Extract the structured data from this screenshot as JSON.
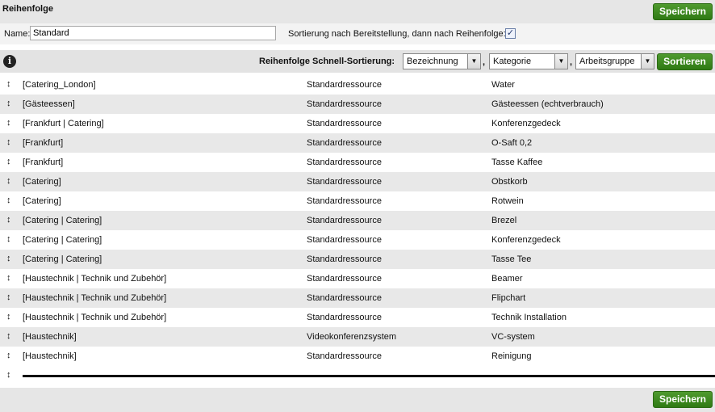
{
  "header": {
    "title": "Reihenfolge",
    "save_label": "Speichern"
  },
  "name_row": {
    "name_label": "Name:",
    "name_value": "Standard",
    "sort_option_label": "Sortierung nach Bereitstellung, dann nach Reihenfolge:",
    "sort_option_checked": true,
    "check_glyph": "✓"
  },
  "quick_sort": {
    "info_glyph": "i",
    "label": "Reihenfolge Schnell-Sortierung:",
    "select1": "Bezeichnung",
    "select2": "Kategorie",
    "select3": "Arbeitsgruppe",
    "separator": ",",
    "sort_button": "Sortieren",
    "dropdown_glyph": "▼"
  },
  "rows": [
    {
      "group": "[Catering_London]",
      "resource": "Standardressource",
      "item": "Water"
    },
    {
      "group": "[Gästeessen]",
      "resource": "Standardressource",
      "item": "Gästeessen (echtverbrauch)"
    },
    {
      "group": "[Frankfurt | Catering]",
      "resource": "Standardressource",
      "item": "Konferenzgedeck"
    },
    {
      "group": "[Frankfurt]",
      "resource": "Standardressource",
      "item": "O-Saft 0,2"
    },
    {
      "group": "[Frankfurt]",
      "resource": "Standardressource",
      "item": "Tasse Kaffee"
    },
    {
      "group": "[Catering]",
      "resource": "Standardressource",
      "item": "Obstkorb"
    },
    {
      "group": "[Catering]",
      "resource": "Standardressource",
      "item": "Rotwein"
    },
    {
      "group": "[Catering | Catering]",
      "resource": "Standardressource",
      "item": "Brezel"
    },
    {
      "group": "[Catering | Catering]",
      "resource": "Standardressource",
      "item": "Konferenzgedeck"
    },
    {
      "group": "[Catering | Catering]",
      "resource": "Standardressource",
      "item": "Tasse Tee"
    },
    {
      "group": "[Haustechnik | Technik und Zubehör]",
      "resource": "Standardressource",
      "item": "Beamer"
    },
    {
      "group": "[Haustechnik | Technik und Zubehör]",
      "resource": "Standardressource",
      "item": "Flipchart"
    },
    {
      "group": "[Haustechnik | Technik und Zubehör]",
      "resource": "Standardressource",
      "item": "Technik Installation"
    },
    {
      "group": "[Haustechnik]",
      "resource": "Videokonferenzsystem",
      "item": "VC-system"
    },
    {
      "group": "[Haustechnik]",
      "resource": "Standardressource",
      "item": "Reinigung"
    }
  ],
  "drag_handle_glyph": "↕",
  "footer": {
    "save_label": "Speichern"
  }
}
